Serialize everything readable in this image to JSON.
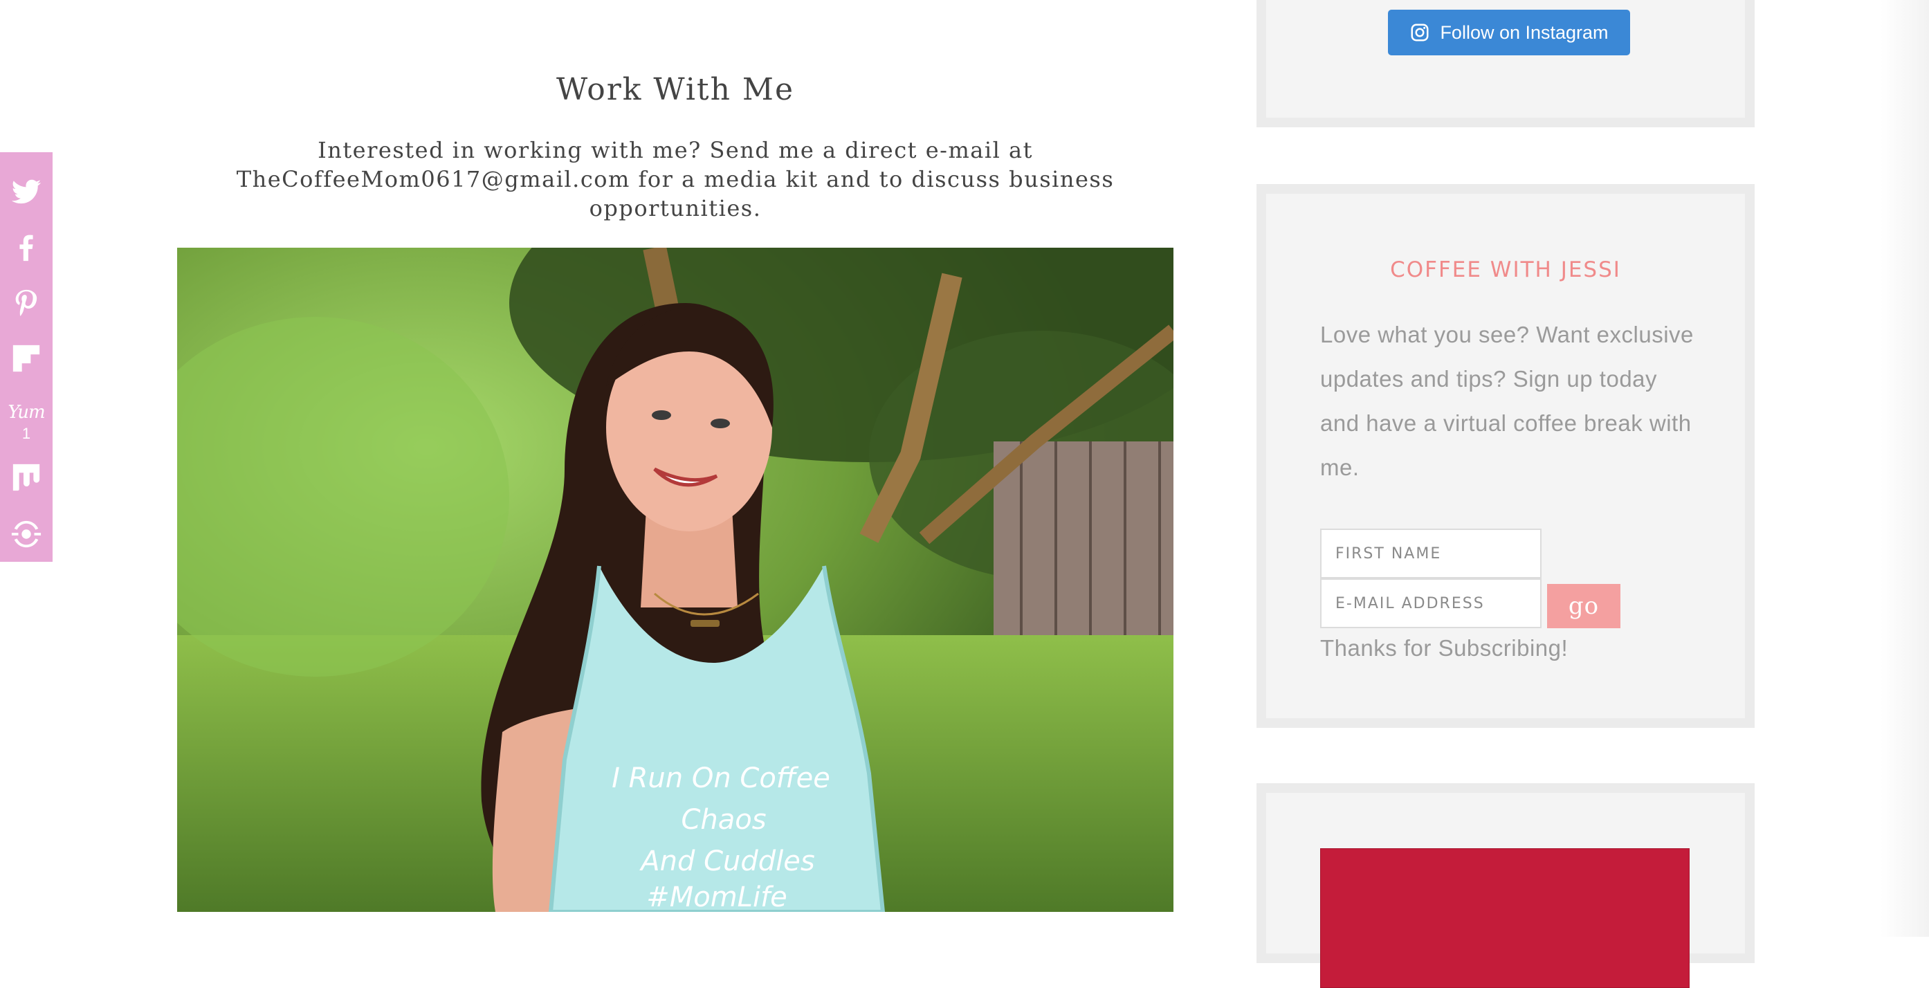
{
  "share_bar": {
    "items": [
      {
        "name": "twitter",
        "icon": "twitter-icon"
      },
      {
        "name": "facebook",
        "icon": "facebook-icon"
      },
      {
        "name": "pinterest",
        "icon": "pinterest-icon"
      },
      {
        "name": "flipboard",
        "icon": "flipboard-icon"
      },
      {
        "name": "yummly",
        "icon": "yummly-icon",
        "label": "Yum",
        "count": "1"
      },
      {
        "name": "mix",
        "icon": "mix-icon"
      },
      {
        "name": "more",
        "icon": "more-share-icon"
      }
    ],
    "color": "#e8a8d6"
  },
  "main": {
    "title": "Work With Me",
    "intro": "Interested in working with me? Send me a direct e-mail at TheCoffeeMom0617@gmail.com for a media kit and to discuss business opportunities.",
    "photo_shirt_text": [
      "I Run On Coffee",
      "Chaos",
      "And Cuddles",
      "#MomLife"
    ]
  },
  "sidebar": {
    "instagram_button": {
      "label": "Follow on Instagram",
      "icon": "instagram-icon",
      "color": "#3b88d6"
    },
    "subscribe": {
      "title": "COFFEE WITH JESSI",
      "text": "Love what you see? Want exclusive updates and tips? Sign up today and have a virtual coffee break with me.",
      "first_name_placeholder": "FIRST NAME",
      "email_placeholder": "E-MAIL ADDRESS",
      "go_label": "go",
      "thanks": "Thanks for Subscribing!",
      "accent": "#f08a8a"
    },
    "promo": {
      "color": "#c41c3a"
    }
  }
}
